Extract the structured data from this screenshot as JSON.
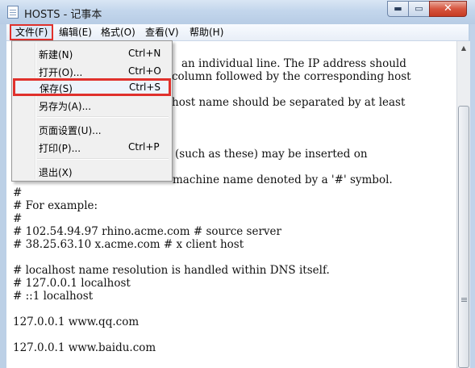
{
  "window": {
    "title": "HOSTS - 记事本",
    "controls": {
      "minimize": "▬",
      "maximize": "▭",
      "close": "✕"
    }
  },
  "menubar": {
    "items": [
      "文件(F)",
      "编辑(E)",
      "格式(O)",
      "查看(V)",
      "帮助(H)"
    ],
    "active": "文件(F)"
  },
  "file_menu": {
    "items": [
      {
        "label": "新建(N)",
        "shortcut": "Ctrl+N"
      },
      {
        "label": "打开(O)...",
        "shortcut": "Ctrl+O"
      },
      {
        "label": "保存(S)",
        "shortcut": "Ctrl+S"
      },
      {
        "label": "另存为(A)...",
        "shortcut": ""
      },
      {
        "label": "页面设置(U)...",
        "shortcut": ""
      },
      {
        "label": "打印(P)...",
        "shortcut": "Ctrl+P"
      },
      {
        "label": "退出(X)",
        "shortcut": ""
      }
    ],
    "highlighted": "保存(S)"
  },
  "editor": {
    "lines": [
      "an individual line. The IP address should",
      "column followed by the corresponding host",
      "host name should be separated by at least",
      "(such as these) may be inserted on",
      "machine name denoted by a '#' symbol.",
      "#",
      "# For example:",
      "#",
      "# 102.54.94.97 rhino.acme.com # source server",
      "# 38.25.63.10 x.acme.com # x client host",
      "# localhost name resolution is handled within DNS itself.",
      "# 127.0.0.1 localhost",
      "# ::1 localhost",
      "127.0.0.1 www.qq.com",
      "127.0.0.1 www.baidu.com"
    ]
  },
  "scrollbar": {
    "up_arrow": "▲"
  },
  "colors": {
    "highlight_border": "#e0312c",
    "close_button": "#c63a22"
  }
}
